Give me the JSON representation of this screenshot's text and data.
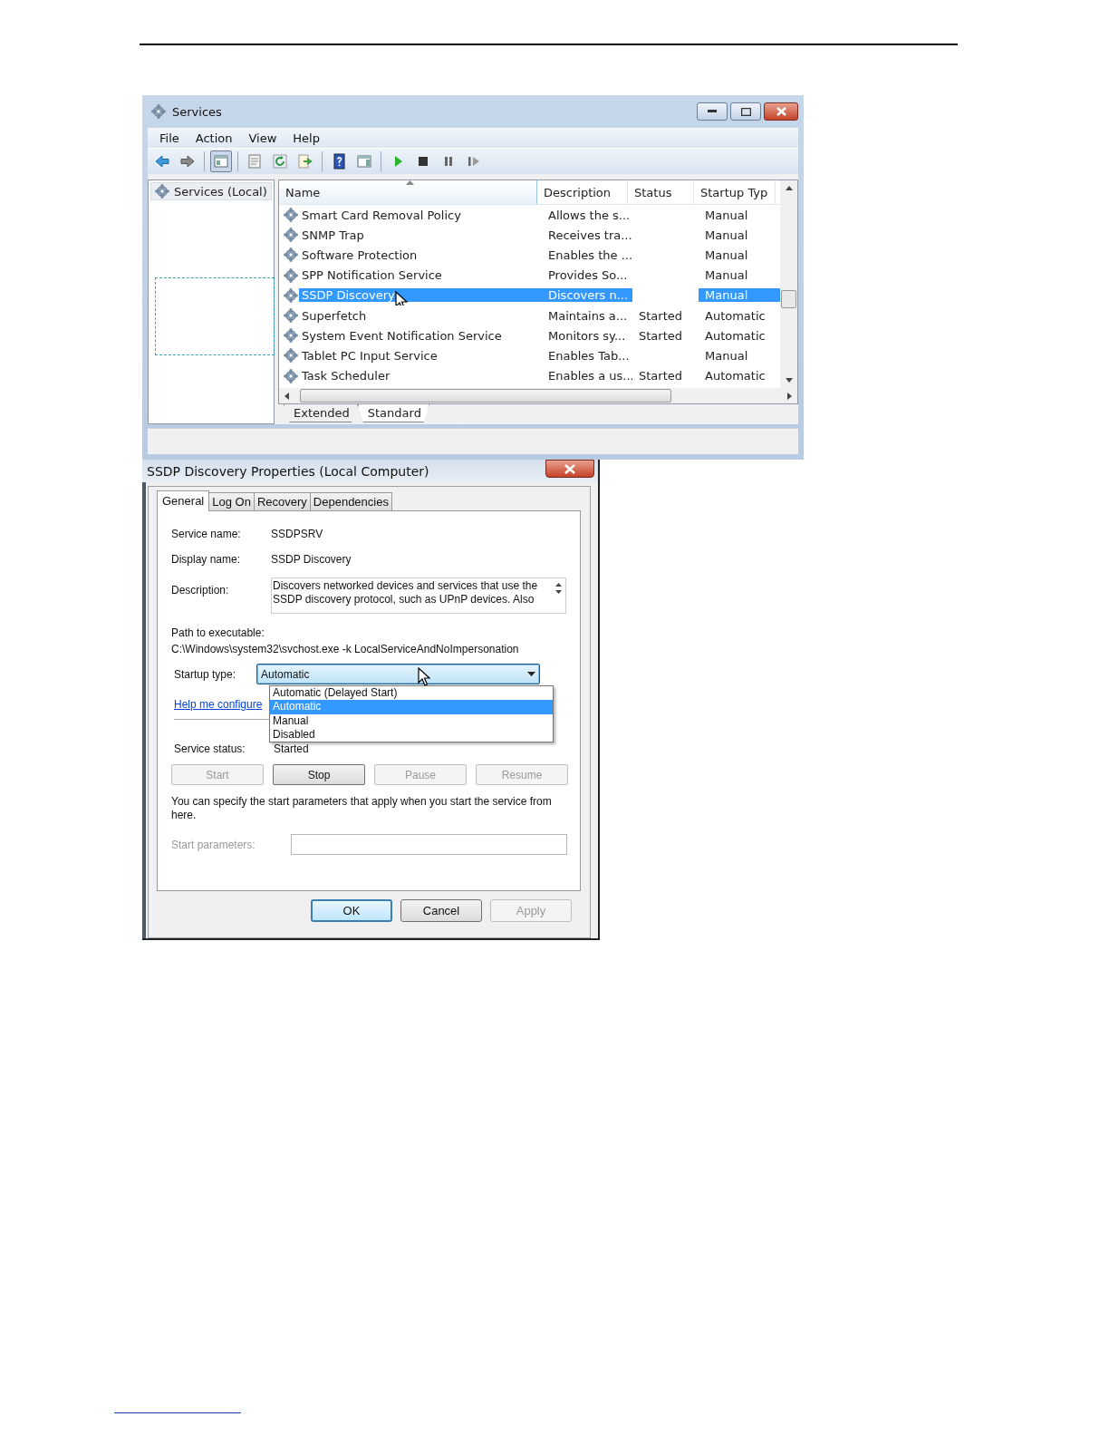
{
  "services_window": {
    "title": "Services",
    "menu": [
      "File",
      "Action",
      "View",
      "Help"
    ],
    "toolbar": [
      {
        "kind": "back",
        "pressed": false
      },
      {
        "kind": "forward",
        "pressed": false
      },
      {
        "kind": "tree",
        "pressed": true
      },
      {
        "kind": "properties",
        "pressed": false
      },
      {
        "kind": "refresh",
        "pressed": false
      },
      {
        "kind": "export",
        "pressed": false
      },
      {
        "kind": "help",
        "pressed": false
      },
      {
        "kind": "panel",
        "pressed": false
      },
      {
        "kind": "play",
        "pressed": false
      },
      {
        "kind": "stop",
        "pressed": false
      },
      {
        "kind": "pause",
        "pressed": false
      },
      {
        "kind": "resume",
        "pressed": false
      }
    ],
    "tree": {
      "label": "Services (Local)",
      "selected": true
    },
    "table": {
      "columns": [
        "Name",
        "Description",
        "Status",
        "Startup Typ"
      ],
      "rows": [
        {
          "name": "Smart Card Removal Policy",
          "description": "Allows the s...",
          "startup": "Manual",
          "selected": false
        },
        {
          "name": "SNMP Trap",
          "description": "Receives tra...",
          "startup": "Manual",
          "selected": false
        },
        {
          "name": "Software Protection",
          "description": "Enables the ...",
          "startup": "Manual",
          "selected": false
        },
        {
          "name": "SPP Notification Service",
          "description": "Provides So...",
          "startup": "Manual",
          "selected": false
        },
        {
          "name": "SSDP Discovery",
          "description": "Discovers n...",
          "startup": "Manual",
          "selected": true
        },
        {
          "name": "Superfetch",
          "description": "Maintains a...",
          "status": "Started",
          "startup": "Automatic",
          "selected": false
        },
        {
          "name": "System Event Notification Service",
          "description": "Monitors sy...",
          "status": "Started",
          "startup": "Automatic",
          "selected": false
        },
        {
          "name": "Tablet PC Input Service",
          "description": "Enables Tab...",
          "startup": "Manual",
          "selected": false
        },
        {
          "name": "Task Scheduler",
          "description": "Enables a us...",
          "status": "Started",
          "startup": "Automatic",
          "selected": false
        }
      ]
    },
    "view_tabs": [
      {
        "label": "Extended",
        "selected": false
      },
      {
        "label": "Standard",
        "selected": true
      }
    ]
  },
  "properties_dialog": {
    "title": "SSDP Discovery Properties (Local Computer)",
    "tabs": [
      {
        "label": "General",
        "selected": true
      },
      {
        "label": "Log On",
        "selected": false
      },
      {
        "label": "Recovery",
        "selected": false
      },
      {
        "label": "Dependencies",
        "selected": false
      }
    ],
    "service_name": {
      "label": "Service name:",
      "value": "SSDPSRV"
    },
    "display_name": {
      "label": "Display name:",
      "value": "SSDP Discovery"
    },
    "description": {
      "label": "Description:",
      "value": "Discovers networked devices and services that use the SSDP discovery protocol, such as UPnP devices. Also"
    },
    "path": {
      "label": "Path to executable:",
      "value": "C:\\Windows\\system32\\svchost.exe -k LocalServiceAndNoImpersonation"
    },
    "startup_type": {
      "label": "Startup type:",
      "value": "Automatic",
      "expanded": true,
      "options": [
        {
          "label": "Automatic (Delayed Start)",
          "selected": false
        },
        {
          "label": "Automatic",
          "selected": true
        },
        {
          "label": "Manual",
          "selected": false
        },
        {
          "label": "Disabled",
          "selected": false
        }
      ]
    },
    "help_link": "Help me configure",
    "service_status": {
      "label": "Service status:",
      "value": "Started"
    },
    "control_buttons": [
      {
        "label": "Start",
        "disabled": true
      },
      {
        "label": "Stop",
        "disabled": false
      },
      {
        "label": "Pause",
        "disabled": true
      },
      {
        "label": "Resume",
        "disabled": true
      }
    ],
    "note": "You can specify the start parameters that apply when you start the service from here.",
    "start_parameters": {
      "label": "Start parameters:",
      "disabled": true
    },
    "buttons": [
      {
        "label": "OK",
        "default": true,
        "disabled": false
      },
      {
        "label": "Cancel",
        "default": false,
        "disabled": false
      },
      {
        "label": "Apply",
        "default": false,
        "disabled": true
      }
    ]
  }
}
